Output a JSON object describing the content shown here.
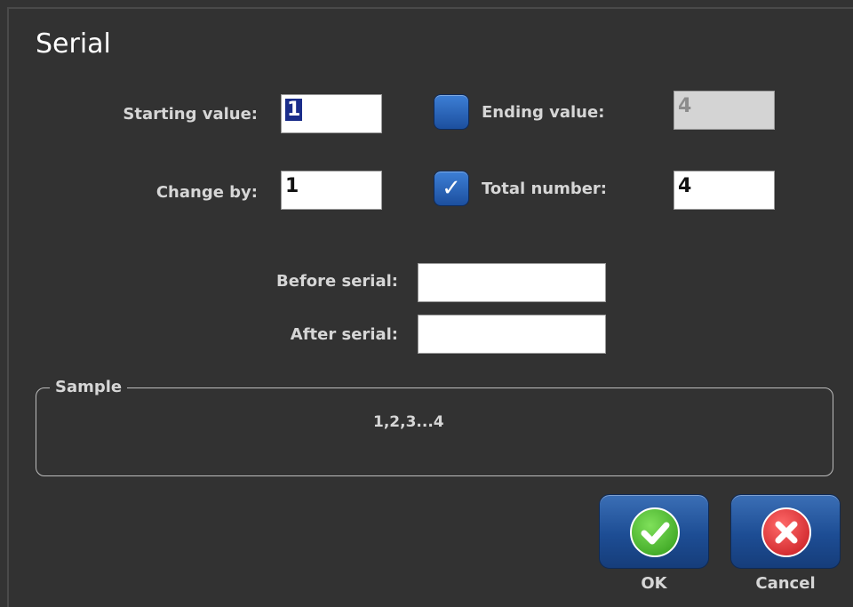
{
  "dialog": {
    "title": "Serial"
  },
  "fields": {
    "starting_value": {
      "label": "Starting value:",
      "value": "1"
    },
    "change_by": {
      "label": "Change by:",
      "value": "1"
    },
    "ending_value": {
      "label": "Ending value:",
      "value": "4",
      "checked": false,
      "enabled": false
    },
    "total_number": {
      "label": "Total number:",
      "value": "4",
      "checked": true
    },
    "before_serial": {
      "label": "Before serial:",
      "value": ""
    },
    "after_serial": {
      "label": "After serial:",
      "value": ""
    }
  },
  "sample": {
    "legend": "Sample",
    "text": "1,2,3...4"
  },
  "buttons": {
    "ok": {
      "label": "OK",
      "icon": "check-circle-icon",
      "color": "#3bb01f"
    },
    "cancel": {
      "label": "Cancel",
      "icon": "x-circle-icon",
      "color": "#d9262c"
    }
  },
  "colors": {
    "background": "#323232",
    "accent_blue": "#1d4d94"
  }
}
